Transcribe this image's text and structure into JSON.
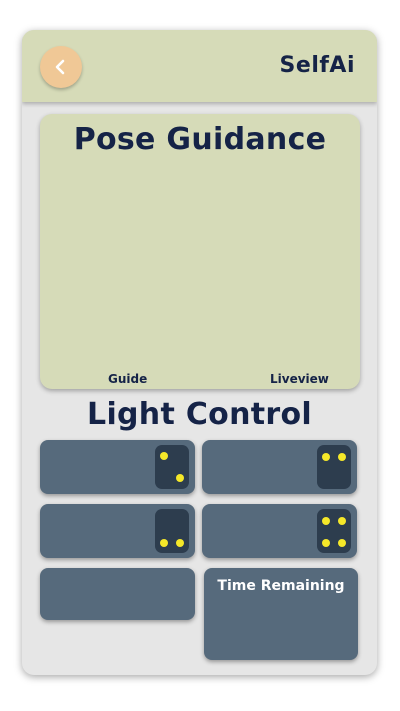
{
  "header": {
    "app_title": "SelfAi",
    "back_icon": "chevron-left-icon"
  },
  "pose_guidance": {
    "title": "Pose Guidance",
    "guide_label": "Guide",
    "liveview_label": "Liveview"
  },
  "light_control": {
    "title": "Light Control",
    "tiles": [
      {
        "name": "light-1",
        "pips": 2
      },
      {
        "name": "light-2",
        "pips": 2
      },
      {
        "name": "light-3",
        "pips": 2
      },
      {
        "name": "light-4",
        "pips": 4
      }
    ],
    "time_remaining_label": "Time Remaining"
  },
  "colors": {
    "header_bg": "#d6dbb8",
    "accent_back": "#f0c896",
    "title_text": "#152347",
    "tile_bg": "#566a7c",
    "pip": "#f5e829"
  }
}
